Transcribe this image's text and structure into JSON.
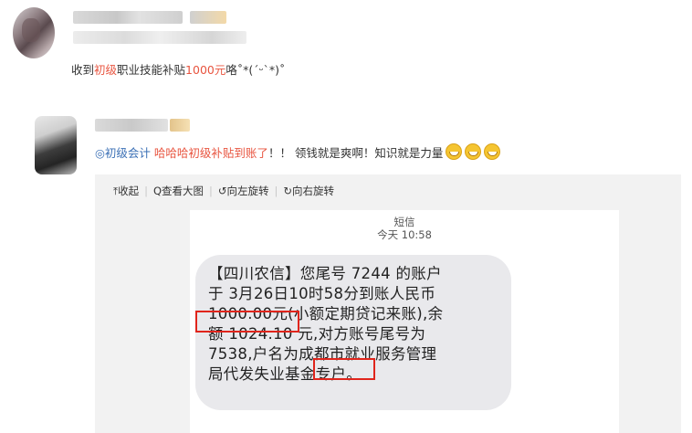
{
  "post": {
    "text_prefix": "收到",
    "text_red1": "初级",
    "text_mid": "职业技能补贴",
    "text_red2": "1000元",
    "text_suffix": "咯˚*(ˊᵕˋ*)˚"
  },
  "reply": {
    "tag_icon": "◎",
    "tag_label": "初级会计",
    "highlight": "哈哈哈初级补贴到账了",
    "text": "！！ 领钱就是爽啊！知识就是力量"
  },
  "toolbar": {
    "collapse": "⤒收起",
    "view_large": "Q查看大图",
    "rotate_left": "↺向左旋转",
    "rotate_right": "↻向右旋转"
  },
  "sms": {
    "header": "短信",
    "time": "今天 10:58",
    "line1": "【四川农信】您尾号 7244 的账户",
    "line2": "于 3月26日10时58分到账人民币",
    "line3_amount": "1000.00元",
    "line3_rest": "(小额定期贷记来账),余",
    "line4": "额 1024.10 元,对方账号尾号为",
    "line5_pre": "7538,户名为",
    "line5_city": "成都市",
    "line5_rest": "就业服务管理",
    "line6": "局代发失业基金专户。"
  },
  "colors": {
    "accent_red": "#e8543f",
    "tag_blue": "#3a6fb5",
    "highlight_box": "#e0251c"
  }
}
